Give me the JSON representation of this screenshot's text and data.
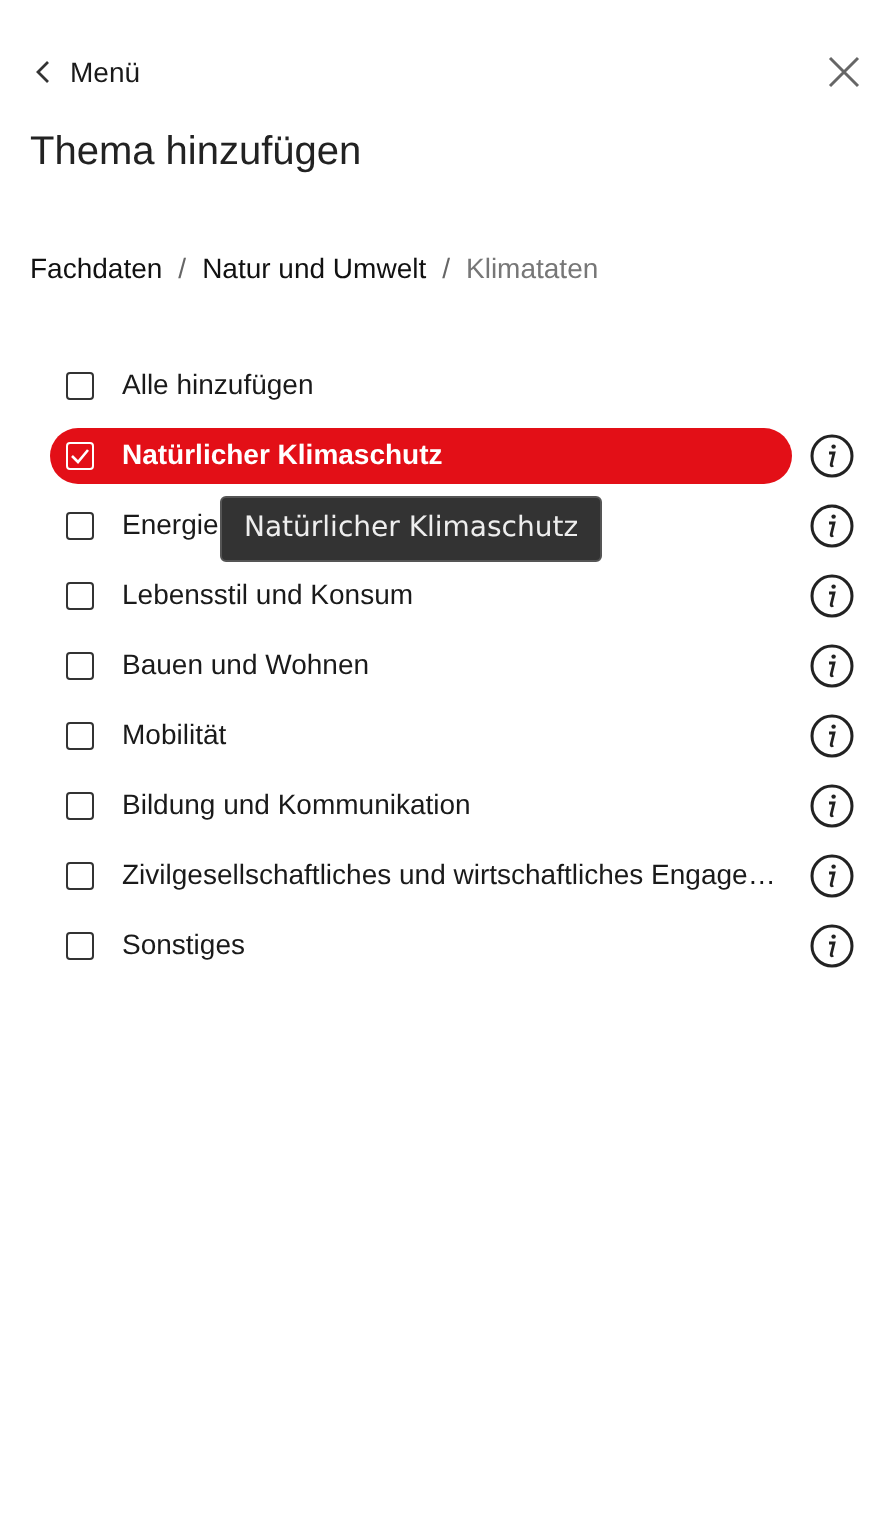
{
  "back": {
    "label": "Menü"
  },
  "title": "Thema hinzufügen",
  "breadcrumb": [
    {
      "label": "Fachdaten",
      "current": false
    },
    {
      "label": "Natur und Umwelt",
      "current": false
    },
    {
      "label": "Klimataten",
      "current": true
    }
  ],
  "breadcrumb_separators": [
    "/",
    "/"
  ],
  "items": [
    {
      "kind": "all",
      "label": "Alle hinzufügen",
      "checked": false,
      "selected": false
    },
    {
      "kind": "topic",
      "label": "Natürlicher Klimaschutz",
      "checked": true,
      "selected": true
    },
    {
      "kind": "topic",
      "label": "Energie",
      "checked": false,
      "selected": false
    },
    {
      "kind": "topic",
      "label": "Lebensstil und Konsum",
      "checked": false,
      "selected": false
    },
    {
      "kind": "topic",
      "label": "Bauen und Wohnen",
      "checked": false,
      "selected": false
    },
    {
      "kind": "topic",
      "label": "Mobilität",
      "checked": false,
      "selected": false
    },
    {
      "kind": "topic",
      "label": "Bildung und Kommunikation",
      "checked": false,
      "selected": false
    },
    {
      "kind": "topic",
      "label": "Zivilgesellschaftliches und wirtschaftliches Engage…",
      "checked": false,
      "selected": false
    },
    {
      "kind": "topic",
      "label": "Sonstiges",
      "checked": false,
      "selected": false
    }
  ],
  "tooltip": {
    "text": "Natürlicher Klimaschutz"
  }
}
